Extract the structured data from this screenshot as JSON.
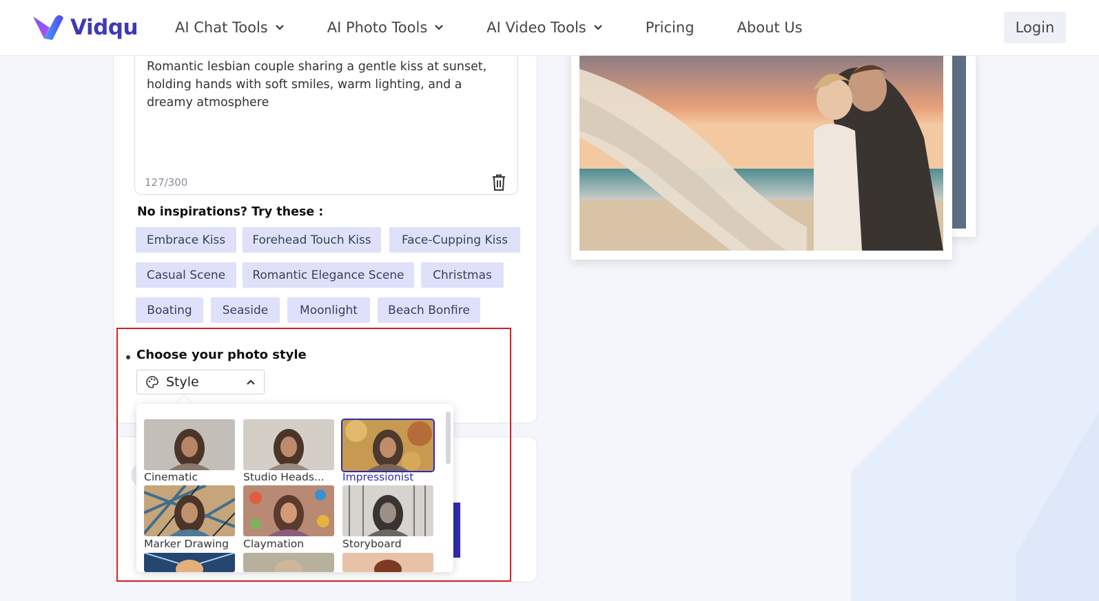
{
  "brand": {
    "name": "Vidqu"
  },
  "nav": {
    "items": [
      {
        "label": "AI Chat Tools",
        "has_dropdown": true
      },
      {
        "label": "AI Photo Tools",
        "has_dropdown": true
      },
      {
        "label": "AI Video Tools",
        "has_dropdown": true
      },
      {
        "label": "Pricing",
        "has_dropdown": false
      },
      {
        "label": "About Us",
        "has_dropdown": false
      }
    ],
    "login_label": "Login"
  },
  "prompt": {
    "value": "Romantic lesbian couple sharing a gentle kiss at sunset, holding hands with soft smiles, warm lighting, and a dreamy atmosphere",
    "counter": "127/300"
  },
  "inspirations": {
    "title": "No inspirations?  Try these :",
    "chips": [
      "Embrace Kiss",
      "Forehead Touch Kiss",
      "Face-Cupping Kiss",
      "Casual Scene",
      "Romantic Elegance Scene",
      "Christmas",
      "Boating",
      "Seaside",
      "Moonlight",
      "Beach Bonfire"
    ]
  },
  "style": {
    "title": "Choose your photo style",
    "select_label": "Style",
    "options": [
      {
        "label": "Cinematic",
        "selected": false
      },
      {
        "label": "Studio Heads...",
        "selected": false
      },
      {
        "label": "Impressionist",
        "selected": true
      },
      {
        "label": "Marker Drawing",
        "selected": false
      },
      {
        "label": "Claymation",
        "selected": false
      },
      {
        "label": "Storyboard",
        "selected": false
      }
    ]
  },
  "colors": {
    "brand": "#3d3ab5",
    "chip_bg": "#dfe1fa",
    "highlight_frame": "#d81e23",
    "selected": "#2f2bb0"
  },
  "icons": [
    "chevron-down-icon",
    "trash-icon",
    "palette-icon",
    "chevron-up-icon"
  ]
}
